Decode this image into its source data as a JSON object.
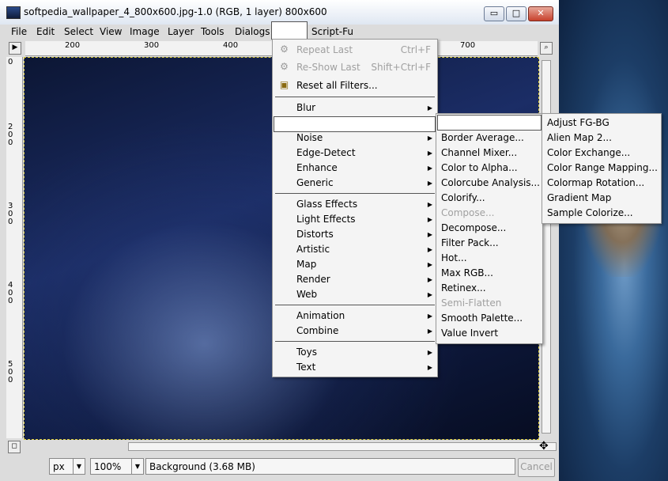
{
  "window": {
    "title": "softpedia_wallpaper_4_800x600.jpg-1.0 (RGB, 1 layer) 800x600",
    "minimize": "▭",
    "maximize": "□",
    "close": "✕"
  },
  "menubar": {
    "items": [
      "File",
      "Edit",
      "Select",
      "View",
      "Image",
      "Layer",
      "Tools",
      "Dialogs",
      "",
      "Script-Fu"
    ]
  },
  "rulers": {
    "top_ticks": [
      "200",
      "300",
      "400",
      "700"
    ],
    "left_ticks": [
      "0",
      "200",
      "300",
      "400",
      "500"
    ]
  },
  "filters_menu": {
    "top_items": [
      {
        "label": "Repeat Last",
        "shortcut": "Ctrl+F",
        "enabled": false
      },
      {
        "label": "Re-Show Last",
        "shortcut": "Shift+Ctrl+F",
        "enabled": false
      },
      {
        "label": "Reset all Filters...",
        "shortcut": "",
        "enabled": true
      }
    ],
    "group1": [
      "Blur",
      ""
    ],
    "group2": [
      "Noise",
      "Edge-Detect",
      "Enhance",
      "Generic"
    ],
    "group3": [
      "Glass Effects",
      "Light Effects",
      "Distorts",
      "Artistic",
      "Map",
      "Render",
      "Web"
    ],
    "group4": [
      "Animation",
      "Combine"
    ],
    "group5": [
      "Toys",
      "Text"
    ]
  },
  "colors_submenu": {
    "items": [
      {
        "label": "",
        "enabled": true
      },
      {
        "label": "Border Average...",
        "enabled": true
      },
      {
        "label": "Channel Mixer...",
        "enabled": true
      },
      {
        "label": "Color to Alpha...",
        "enabled": true
      },
      {
        "label": "Colorcube Analysis...",
        "enabled": true
      },
      {
        "label": "Colorify...",
        "enabled": true
      },
      {
        "label": "Compose...",
        "enabled": false
      },
      {
        "label": "Decompose...",
        "enabled": true
      },
      {
        "label": "Filter Pack...",
        "enabled": true
      },
      {
        "label": "Hot...",
        "enabled": true
      },
      {
        "label": "Max RGB...",
        "enabled": true
      },
      {
        "label": "Retinex...",
        "enabled": true
      },
      {
        "label": "Semi-Flatten",
        "enabled": false
      },
      {
        "label": "Smooth Palette...",
        "enabled": true
      },
      {
        "label": "Value Invert",
        "enabled": true
      }
    ]
  },
  "map_submenu": {
    "items": [
      "Adjust FG-BG",
      "Alien Map 2...",
      "Color Exchange...",
      "Color Range Mapping...",
      "Colormap Rotation...",
      "Gradient Map",
      "Sample Colorize..."
    ]
  },
  "statusbar": {
    "unit": "px",
    "zoom": "100%",
    "layer_info": "Background (3.68 MB)",
    "cancel": "Cancel"
  }
}
